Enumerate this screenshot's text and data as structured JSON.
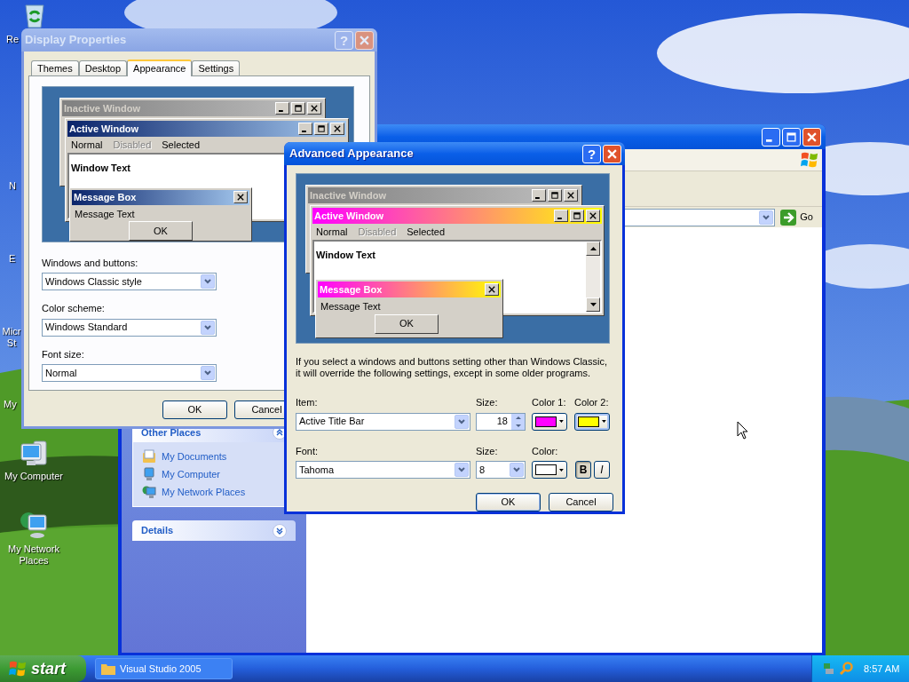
{
  "desktop_icons": [
    {
      "label": "Re",
      "kind": "recycle-bin"
    },
    {
      "label": "N"
    },
    {
      "label": "E"
    },
    {
      "label": "Micr St"
    },
    {
      "label": "My"
    },
    {
      "label": "My Computer",
      "kind": "computer"
    },
    {
      "label": "My Network Places",
      "kind": "network"
    }
  ],
  "explorer": {
    "go_button": "Go",
    "other_places": {
      "title": "Other Places",
      "items": [
        {
          "label": "My Documents",
          "kind": "documents"
        },
        {
          "label": "My Computer",
          "kind": "computer"
        },
        {
          "label": "My Network Places",
          "kind": "network"
        }
      ]
    },
    "details": {
      "title": "Details"
    }
  },
  "display_properties": {
    "title": "Display Properties",
    "help_button": "?",
    "tabs": [
      {
        "label": "Themes",
        "selected": false
      },
      {
        "label": "Desktop",
        "selected": false
      },
      {
        "label": "Appearance",
        "selected": true
      },
      {
        "label": "Settings",
        "selected": false
      }
    ],
    "preview": {
      "inactive_title": "Inactive Window",
      "active_title": "Active Window",
      "menu": [
        {
          "label": "Normal",
          "disabled": false
        },
        {
          "label": "Disabled",
          "disabled": true
        },
        {
          "label": "Selected",
          "disabled": false
        }
      ],
      "window_text": "Window Text",
      "message_title": "Message Box",
      "message_text": "Message Text",
      "ok": "OK"
    },
    "fields": [
      {
        "label": "Windows and buttons:",
        "value": "Windows Classic style"
      },
      {
        "label": "Color scheme:",
        "value": "Windows Standard"
      },
      {
        "label": "Font size:",
        "value": "Normal"
      }
    ],
    "buttons": [
      "OK",
      "Cancel"
    ]
  },
  "advanced_appearance": {
    "title": "Advanced Appearance",
    "help_button": "?",
    "preview": {
      "inactive_title": "Inactive Window",
      "active_title": "Active Window",
      "menu": [
        {
          "label": "Normal",
          "disabled": false
        },
        {
          "label": "Disabled",
          "disabled": true
        },
        {
          "label": "Selected",
          "disabled": false
        }
      ],
      "window_text": "Window Text",
      "message_title": "Message Box",
      "message_text": "Message Text",
      "ok": "OK"
    },
    "note": "If you select a windows and buttons setting other than Windows Classic, it will override the following settings, except in some older programs.",
    "item": {
      "label": "Item:",
      "value": "Active Title Bar"
    },
    "item_size": {
      "label": "Size:",
      "value": "18"
    },
    "color_1": {
      "label": "Color 1:",
      "color": "#ff00ff",
      "focused": false
    },
    "color_2": {
      "label": "Color 2:",
      "color": "#ffff00",
      "focused": true
    },
    "font": {
      "label": "Font:",
      "value": "Tahoma"
    },
    "font_size": {
      "label": "Size:",
      "value": "8"
    },
    "font_color": {
      "label": "Color:",
      "color": "#ffffff",
      "focused": false
    },
    "bold": {
      "label": "B",
      "on": true
    },
    "italic": {
      "label": "I",
      "on": false
    },
    "buttons": [
      "OK",
      "Cancel"
    ]
  },
  "taskbar": {
    "start": "start",
    "tasks": [
      {
        "label": "Visual Studio 2005",
        "selected": false
      }
    ],
    "clock": "8:57 AM"
  }
}
